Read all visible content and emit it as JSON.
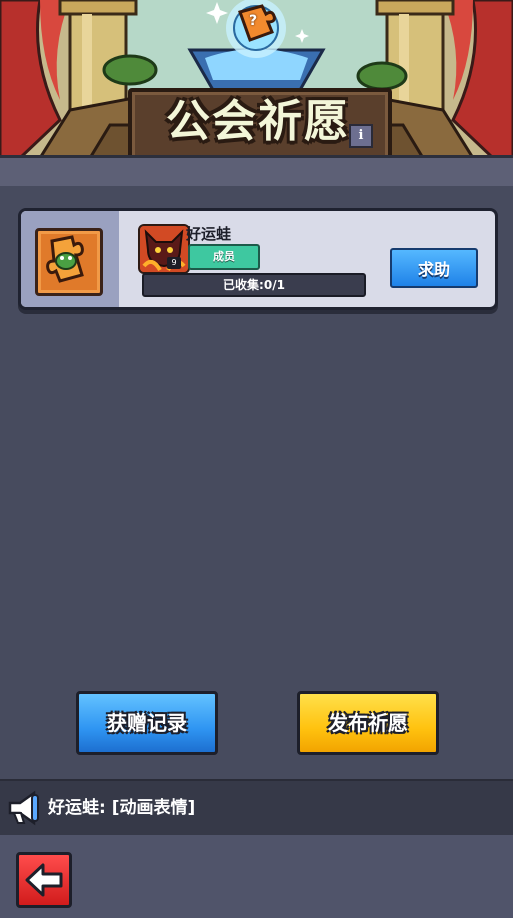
{
  "header": {
    "title": "公会祈愿",
    "info_label": "i",
    "question_icon_label": "?"
  },
  "wish_card": {
    "item_icon": "puzzle-piece-icon",
    "player": {
      "name": "好运蛙",
      "level": "9",
      "role": "成员"
    },
    "progress": {
      "label": "已收集:0/1",
      "collected": 0,
      "total": 1
    },
    "help_button": "求助"
  },
  "actions": {
    "gift_record": "获赠记录",
    "publish_wish": "发布祈愿"
  },
  "message_bar": {
    "icon": "megaphone-icon",
    "text": "好运蛙: [动画表情]"
  },
  "footer": {
    "back_icon": "back-arrow-icon"
  },
  "colors": {
    "background": "#474b5e",
    "help_button": "#2f95f2",
    "publish_button": "#ffc20f",
    "role_badge": "#3ec8a0",
    "back_button": "#e02424"
  }
}
